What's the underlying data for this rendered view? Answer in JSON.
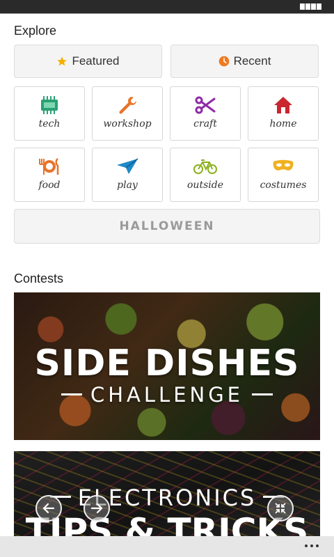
{
  "explore": {
    "title": "Explore",
    "featured_label": "Featured",
    "recent_label": "Recent",
    "categories": [
      {
        "label": "tech",
        "icon": "chip-icon",
        "color": "#2aa174"
      },
      {
        "label": "workshop",
        "icon": "wrench-icon",
        "color": "#e8742a"
      },
      {
        "label": "craft",
        "icon": "scissors-icon",
        "color": "#8e2aa6"
      },
      {
        "label": "home",
        "icon": "house-icon",
        "color": "#c8282e"
      },
      {
        "label": "food",
        "icon": "utensils-icon",
        "color": "#e8742a"
      },
      {
        "label": "play",
        "icon": "paper-plane-icon",
        "color": "#1e88c8"
      },
      {
        "label": "outside",
        "icon": "bicycle-icon",
        "color": "#8cb01e"
      },
      {
        "label": "costumes",
        "icon": "mask-icon",
        "color": "#f0b020"
      }
    ],
    "halloween_label": "HALLOWEEN"
  },
  "contests": {
    "title": "Contests",
    "banners": [
      {
        "line1": "SIDE DISHES",
        "line2": "CHALLENGE"
      },
      {
        "line1": "ELECTRONICS",
        "line2": "TIPS & TRICKS"
      }
    ]
  },
  "colors": {
    "star": "#f4b000",
    "clock": "#f07a20"
  }
}
